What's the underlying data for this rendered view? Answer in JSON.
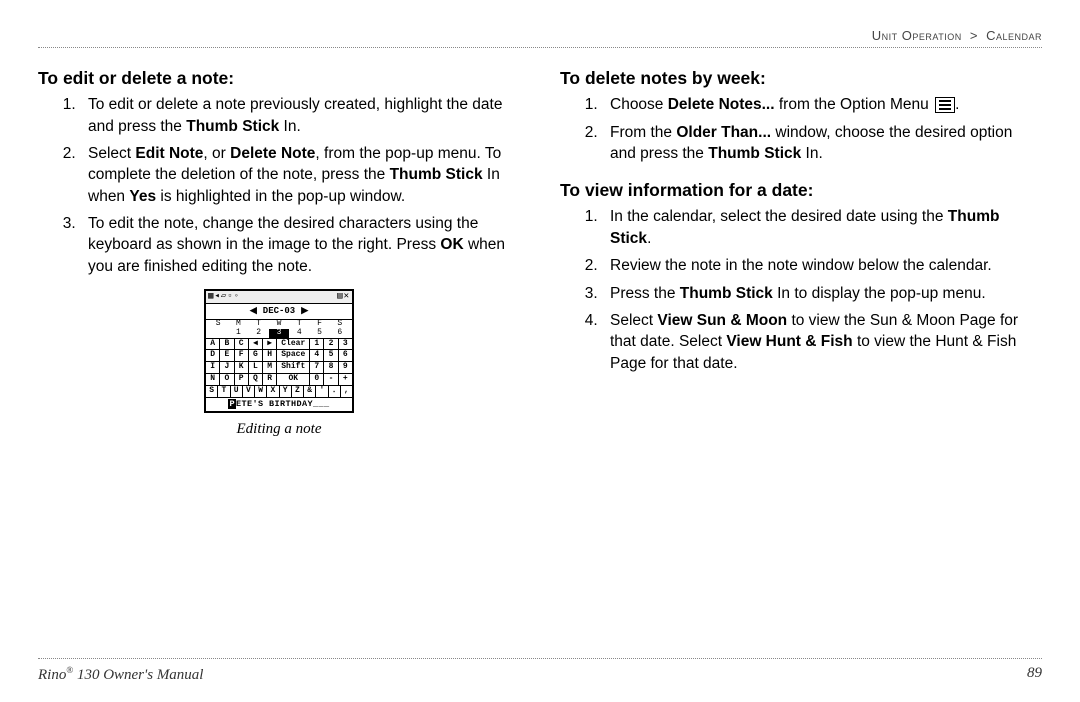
{
  "breadcrumb": {
    "section": "Unit Operation",
    "sep": ">",
    "page": "Calendar"
  },
  "left": {
    "heading": "To edit or delete a note:",
    "items": {
      "i1": {
        "t1": "To edit or delete a note previously created, highlight the date and press the ",
        "b1": "Thumb Stick",
        "t2": " In."
      },
      "i2": {
        "t1": "Select ",
        "b1": "Edit Note",
        "t2": ", or ",
        "b2": "Delete Note",
        "t3": ", from the pop-up menu. To complete the deletion of the note, press the ",
        "b3": "Thumb Stick",
        "t4": " In when ",
        "b4": "Yes",
        "t5": " is highlighted in the pop-up window."
      },
      "i3": {
        "t1": "To edit the note, change the desired characters using the keyboard as shown in the image to the right. Press ",
        "b1": "OK",
        "t2": " when you are finished editing the note."
      }
    },
    "caption": "Editing a note"
  },
  "right": {
    "h1": "To delete notes by week:",
    "l1": {
      "i1": {
        "t1": "Choose ",
        "b1": "Delete Notes...",
        "t2": " from the Option Menu ",
        "t3": "."
      },
      "i2": {
        "t1": "From the ",
        "b1": "Older Than...",
        "t2": " window, choose the desired option and press the ",
        "b2": "Thumb Stick",
        "t3": " In."
      }
    },
    "h2": "To view information for a date:",
    "l2": {
      "i1": {
        "t1": "In the calendar, select the desired date using the ",
        "b1": "Thumb Stick",
        "t2": "."
      },
      "i2": {
        "t1": "Review the note in the note window below the calendar."
      },
      "i3": {
        "t1": "Press the ",
        "b1": "Thumb Stick",
        "t2": " In to display the pop-up menu."
      },
      "i4": {
        "t1": "Select ",
        "b1": "View Sun & Moon",
        "t2": " to view the Sun & Moon Page for that date. Select ",
        "b2": "View Hunt & Fish",
        "t3": " to view the Hunt & Fish Page for that date."
      }
    }
  },
  "figure": {
    "month": "DEC-03",
    "dow": [
      "S",
      "M",
      "T",
      "W",
      "T",
      "F",
      "S"
    ],
    "row1": [
      "",
      "1",
      "2",
      "3",
      "4",
      "5",
      "6"
    ],
    "kb": {
      "r1": [
        "A",
        "B",
        "C",
        "◀",
        "▶",
        "Clear",
        "1",
        "2",
        "3"
      ],
      "r2": [
        "D",
        "E",
        "F",
        "G",
        "H",
        "Space",
        "4",
        "5",
        "6"
      ],
      "r3": [
        "I",
        "J",
        "K",
        "L",
        "M",
        "Shift",
        "7",
        "8",
        "9"
      ],
      "r4": [
        "N",
        "O",
        "P",
        "Q",
        "R",
        "OK",
        "0",
        "-",
        "+"
      ],
      "r5": [
        "S",
        "T",
        "U",
        "V",
        "W",
        "X",
        "Y",
        "Z",
        "&",
        "'",
        "․",
        ","
      ]
    },
    "note_prefix": "P",
    "note_text": "ETE'S BIRTHDAY___"
  },
  "footer": {
    "product": "Rino",
    "reg": "®",
    "model": " 130 Owner's Manual",
    "page": "89"
  }
}
